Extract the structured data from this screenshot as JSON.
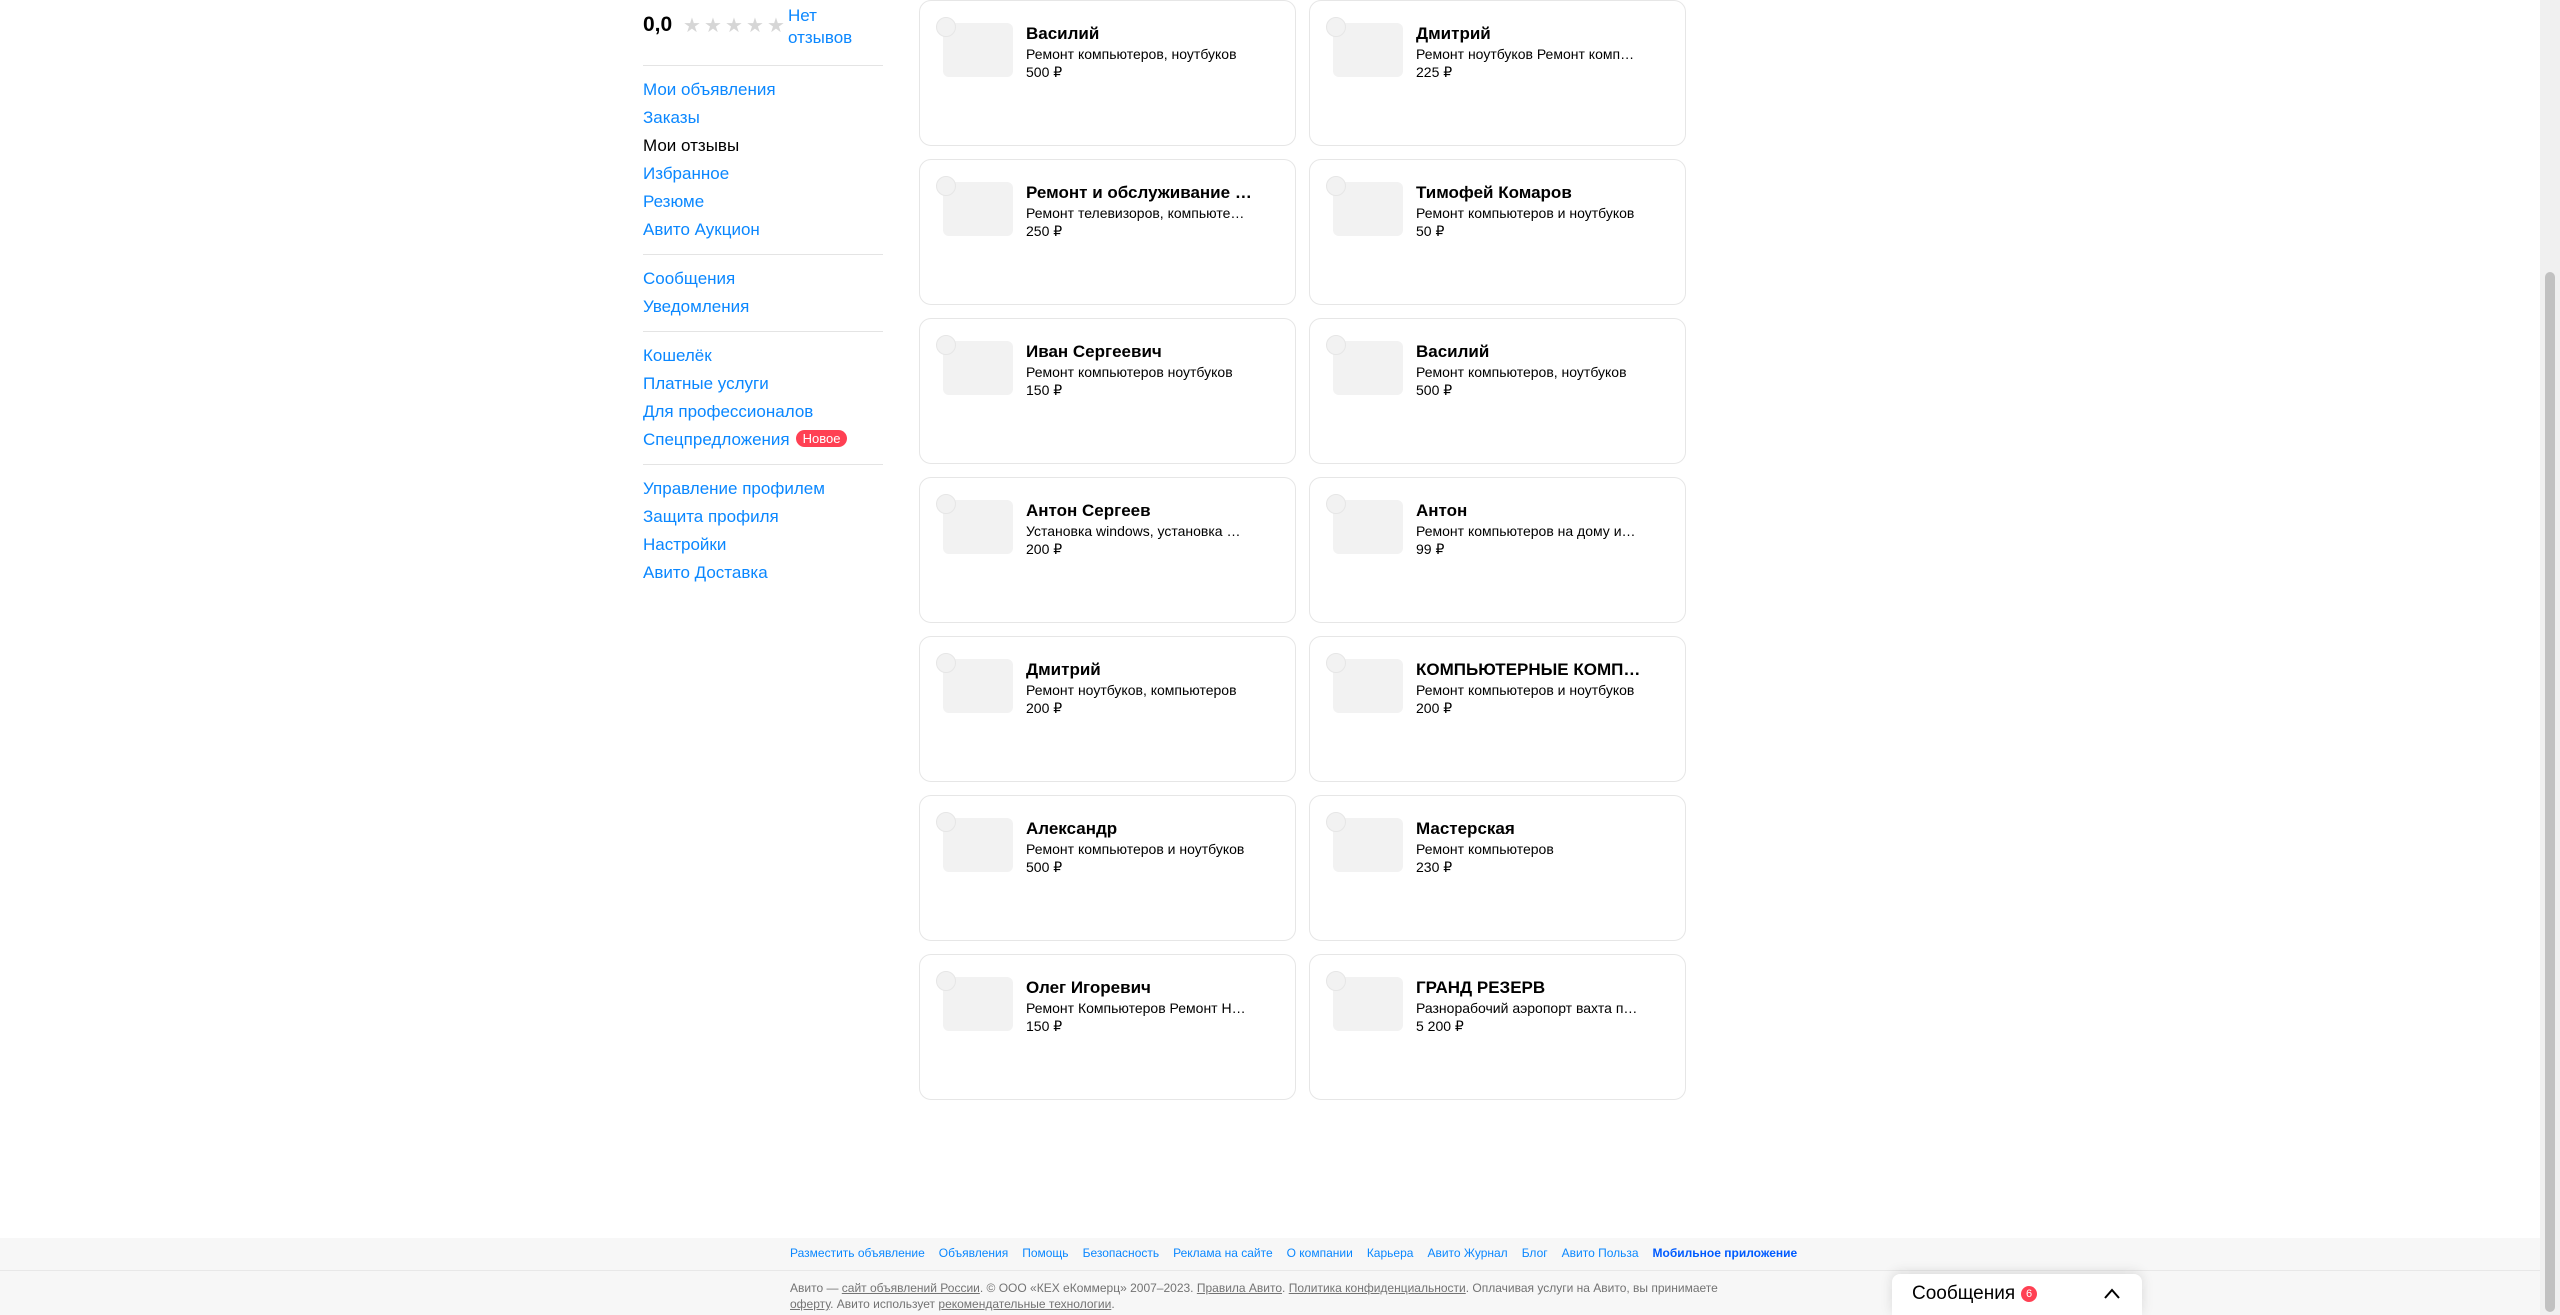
{
  "sidebar": {
    "rating_value": "0,0",
    "no_reviews": "Нет отзывов",
    "groups": [
      [
        "Мои объявления",
        "Заказы",
        "Мои отзывы",
        "Избранное",
        "Резюме",
        "Авито Аукцион"
      ],
      [
        "Сообщения",
        "Уведомления"
      ],
      [
        "Кошелёк",
        "Платные услуги",
        "Для профессионалов",
        "Спецпредложения"
      ],
      [
        "Управление профилем",
        "Защита профиля",
        "Настройки",
        "Авито Доставка"
      ]
    ],
    "active_item": "Мои отзывы",
    "new_badge": "Новое"
  },
  "cards": [
    {
      "name": "Василий",
      "desc": "Ремонт компьютеров, ноутбуков",
      "price": "500 ₽"
    },
    {
      "name": "Дмитрий",
      "desc": "Ремонт ноутбуков Ремонт компьютеров",
      "price": "225 ₽"
    },
    {
      "name": "Ремонт и обслуживание техники",
      "desc": "Ремонт телевизоров, компьютеров",
      "price": "250 ₽"
    },
    {
      "name": "Тимофей Комаров",
      "desc": "Ремонт компьютеров и ноутбуков",
      "price": "50 ₽"
    },
    {
      "name": "Иван Сергеевич",
      "desc": "Ремонт компьютеров ноутбуков",
      "price": "150 ₽"
    },
    {
      "name": "Василий",
      "desc": "Ремонт компьютеров, ноутбуков",
      "price": "500 ₽"
    },
    {
      "name": "Антон Сергеев",
      "desc": "Установка windows, установка программ",
      "price": "200 ₽"
    },
    {
      "name": "Антон",
      "desc": "Ремонт компьютеров на дому и в офисе",
      "price": "99 ₽"
    },
    {
      "name": "Дмитрий",
      "desc": "Ремонт ноутбуков, компьютеров",
      "price": "200 ₽"
    },
    {
      "name": "КОМПЬЮТЕРНЫЕ КОМПЛЕКТУЮЩИЕ",
      "desc": "Ремонт компьютеров и ноутбуков",
      "price": "200 ₽"
    },
    {
      "name": "Александр",
      "desc": "Ремонт компьютеров и ноутбуков",
      "price": "500 ₽"
    },
    {
      "name": "Мастерская",
      "desc": "Ремонт компьютеров",
      "price": "230 ₽"
    },
    {
      "name": "Олег Игоревич",
      "desc": "Ремонт Компьютеров Ремонт Ноутбуков",
      "price": "150 ₽"
    },
    {
      "name": "ГРАНД РЕЗЕРВ",
      "desc": "Разнорабочий аэропорт вахта питание",
      "price": "5 200 ₽"
    }
  ],
  "footer": {
    "links": [
      "Разместить объявление",
      "Объявления",
      "Помощь",
      "Безопасность",
      "Реклама на сайте",
      "О компании",
      "Карьера",
      "Авито Журнал",
      "Блог",
      "Авито Польза",
      "Мобильное приложение"
    ],
    "legal_prefix": "Авито — ",
    "legal_link1": "сайт объявлений России",
    "legal_mid": ". © ООО «КЕХ еКоммерц» 2007–2023. ",
    "legal_link2": "Правила Авито",
    "legal_dot": ". ",
    "legal_link3": "Политика конфиденциальности",
    "legal_mid2": ". Оплачивая услуги на Авито, вы принимаете ",
    "legal_link4": "оферту",
    "legal_mid3": ". Авито использует ",
    "legal_link5": "рекомендательные технологии",
    "legal_end": "."
  },
  "messenger": {
    "label": "Сообщения",
    "count": "6"
  },
  "colors": {
    "link": "#0a87ff",
    "badge": "#ff4053"
  }
}
